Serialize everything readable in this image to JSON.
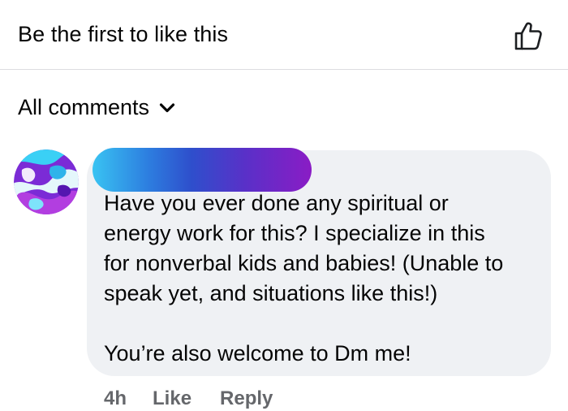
{
  "likes": {
    "text": "Be the first to like this",
    "icon": "thumbs-up-outline-icon"
  },
  "comments_filter": {
    "label": "All comments",
    "icon": "chevron-down-icon"
  },
  "comment": {
    "avatar_icon": "marbled-swirl-avatar",
    "author_redacted": true,
    "body": "Have you ever done any spiritual or\nenergy work for this? I specialize in this\nfor nonverbal kids and babies! (Unable to\nspeak yet, and situations like this!)\n\nYou’re also welcome to Dm me!",
    "time": "4h",
    "like_label": "Like",
    "reply_label": "Reply"
  },
  "colors": {
    "bubble": "#eff1f4",
    "secondary_text": "#65676b",
    "divider": "#dcdde0"
  }
}
